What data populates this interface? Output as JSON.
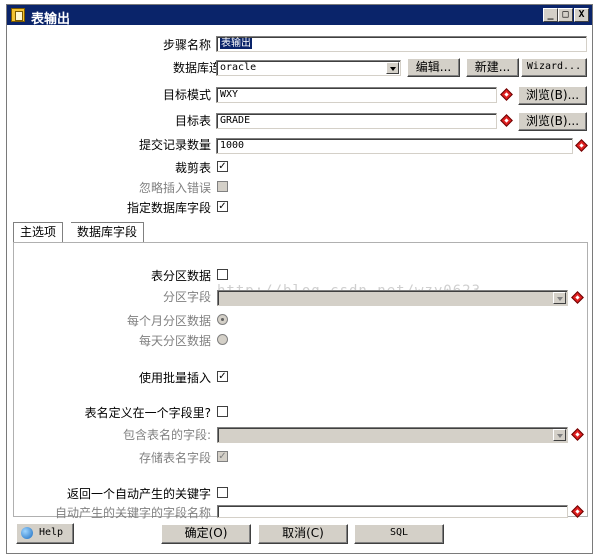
{
  "window": {
    "title": "表输出",
    "btn_min": "_",
    "btn_max": "□",
    "btn_close": "X"
  },
  "form": {
    "step_name": {
      "label": "步骤名称",
      "value": "表输出"
    },
    "db_conn": {
      "label": "数据库连接",
      "value": "oracle",
      "edit": "编辑...",
      "new": "新建...",
      "wizard": "Wizard..."
    },
    "target_schema": {
      "label": "目标模式",
      "value": "WXY",
      "browse": "浏览(B)..."
    },
    "target_table": {
      "label": "目标表",
      "value": "GRADE",
      "browse": "浏览(B)..."
    },
    "commit_size": {
      "label": "提交记录数量",
      "value": "1000"
    },
    "truncate": {
      "label": "裁剪表",
      "checked": true
    },
    "ignore_errors": {
      "label": "忽略插入错误",
      "checked": false
    },
    "specify_fields": {
      "label": "指定数据库字段",
      "checked": true
    }
  },
  "tabs": [
    {
      "label": "主选项"
    },
    {
      "label": "数据库字段"
    }
  ],
  "main_tab": {
    "partition": {
      "label": "表分区数据",
      "checked": false
    },
    "partition_field": {
      "label": "分区字段"
    },
    "monthly": {
      "label": "每个月分区数据",
      "selected": true
    },
    "daily": {
      "label": "每天分区数据",
      "selected": false
    },
    "batch_insert": {
      "label": "使用批量插入",
      "checked": true
    },
    "table_in_field": {
      "label": "表名定义在一个字段里?",
      "checked": false
    },
    "table_name_field": {
      "label": "包含表名的字段:"
    },
    "store_table_name": {
      "label": "存储表名字段",
      "checked": true
    },
    "return_key": {
      "label": "返回一个自动产生的关键字",
      "checked": false
    },
    "key_field_name": {
      "label": "自动产生的关键字的字段名称"
    }
  },
  "watermark": "http://blog.csdn.net/wzy0623",
  "footer": {
    "help": "Help",
    "ok": "确定(O)",
    "cancel": "取消(C)",
    "sql": "SQL"
  },
  "icons": {
    "title_icon": "spoon-table-icon",
    "required": "required-diamond-icon",
    "help": "help-globe-icon"
  },
  "colors": {
    "titlebar": "#0a246a",
    "required": "#e02020",
    "button_face": "#d4d0c8"
  }
}
